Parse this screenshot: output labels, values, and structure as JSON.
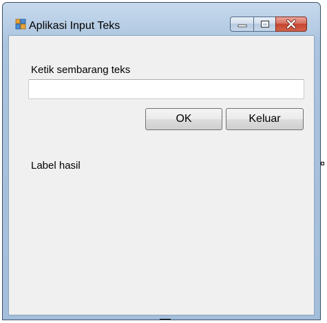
{
  "window": {
    "title": "Aplikasi Input Teks",
    "icon": "windows-form-icon"
  },
  "window_controls": {
    "minimize_icon": "minimize-icon",
    "maximize_icon": "maximize-icon",
    "close_icon": "close-icon",
    "close_color": "#c4452f"
  },
  "form": {
    "prompt_label": "Ketik sembarang teks",
    "input": {
      "value": "",
      "placeholder": ""
    },
    "ok_button": "OK",
    "exit_button": "Keluar",
    "result_label": "Label hasil"
  }
}
